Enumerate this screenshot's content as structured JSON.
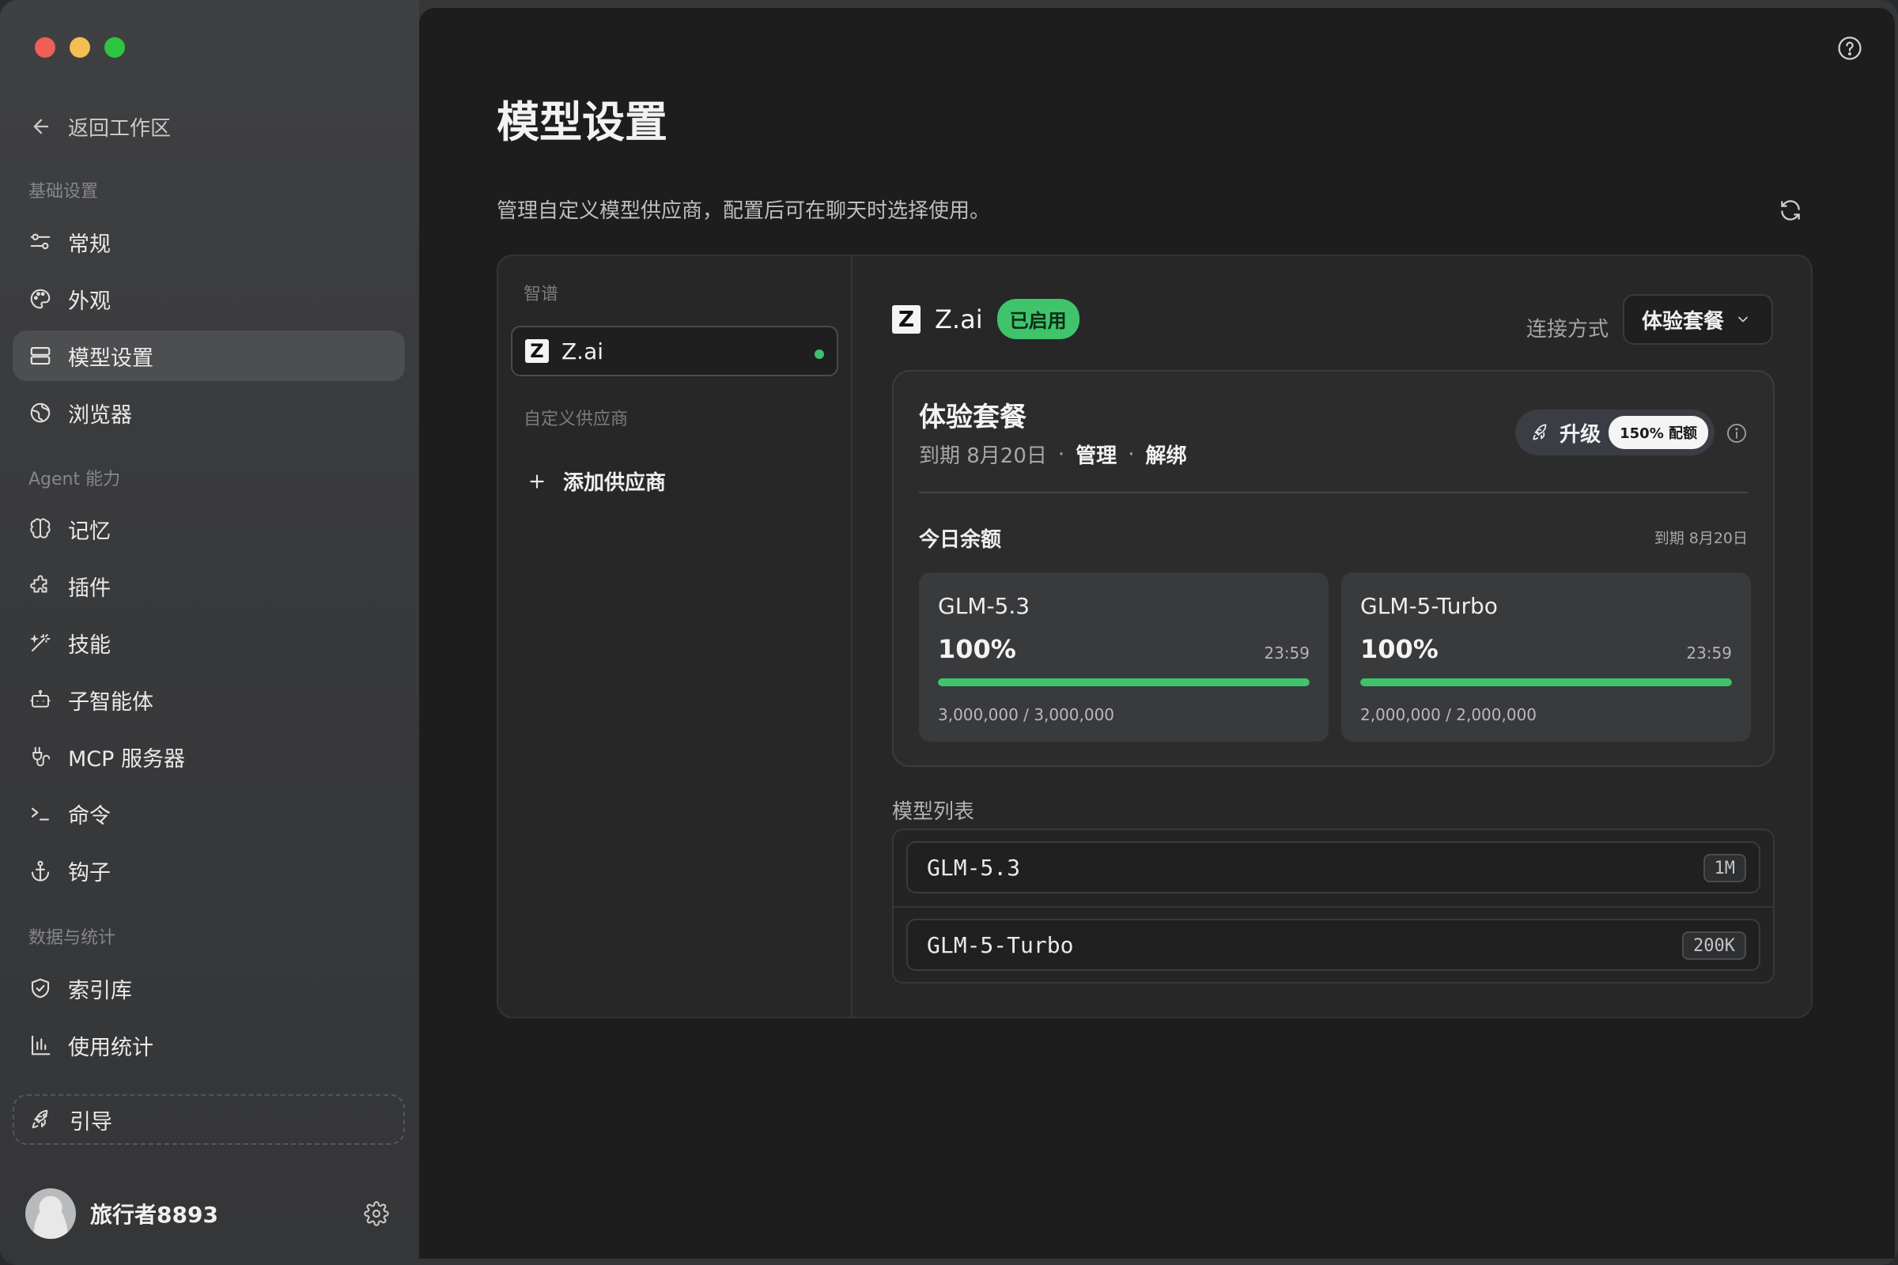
{
  "sidebar": {
    "back_label": "返回工作区",
    "sections": {
      "basic": "基础设置",
      "agent": "Agent 能力",
      "data": "数据与统计"
    },
    "items": {
      "general": "常规",
      "appearance": "外观",
      "models": "模型设置",
      "browser": "浏览器",
      "memory": "记忆",
      "plugins": "插件",
      "skills": "技能",
      "subagents": "子智能体",
      "mcp": "MCP 服务器",
      "commands": "命令",
      "hooks": "钩子",
      "index": "索引库",
      "usage": "使用统计"
    },
    "active_item": "models",
    "guide_label": "引导",
    "user_name": "旅行者8893"
  },
  "main": {
    "title": "模型设置",
    "description": "管理自定义模型供应商，配置后可在聊天时选择使用。",
    "providers": {
      "builtin_label": "智谱",
      "custom_label": "自定义供应商",
      "selected": {
        "name": "Z.ai",
        "logo_letter": "Z",
        "status": "active"
      },
      "add_label": "添加供应商"
    },
    "detail": {
      "provider_name": "Z.ai",
      "logo_letter": "Z",
      "enabled_badge": "已启用",
      "connection_label": "连接方式",
      "connection_value": "体验套餐",
      "plan": {
        "title": "体验套餐",
        "expiry": "到期 8月20日",
        "separator": "·",
        "manage": "管理",
        "unbind": "解绑",
        "upgrade_label": "升级",
        "quota_pill": "150% 配额",
        "today_label": "今日余额",
        "today_expiry": "到期 8月20日",
        "quotas": [
          {
            "name": "GLM-5.3",
            "percent_label": "100%",
            "percent": 100,
            "reset": "23:59",
            "usage": "3,000,000 / 3,000,000"
          },
          {
            "name": "GLM-5-Turbo",
            "percent_label": "100%",
            "percent": 100,
            "reset": "23:59",
            "usage": "2,000,000 / 2,000,000"
          }
        ]
      },
      "models_label": "模型列表",
      "models": [
        {
          "name": "GLM-5.3",
          "context": "1M"
        },
        {
          "name": "GLM-5-Turbo",
          "context": "200K"
        }
      ]
    }
  },
  "colors": {
    "accent_green": "#3fc46c",
    "traffic_red": "#ed5f57",
    "traffic_yellow": "#f4bf4f",
    "traffic_green": "#2ec641"
  }
}
